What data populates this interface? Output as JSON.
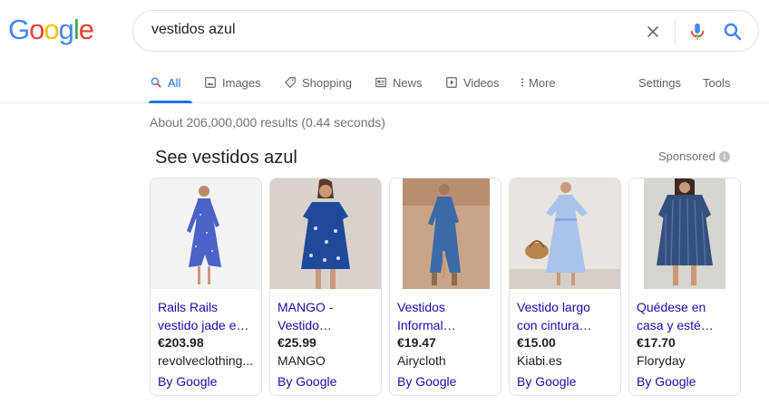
{
  "logo": {
    "letters": [
      "G",
      "o",
      "o",
      "g",
      "l",
      "e"
    ],
    "colors": [
      "#4285f4",
      "#ea4335",
      "#fbbc05",
      "#4285f4",
      "#34a853",
      "#ea4335"
    ]
  },
  "search": {
    "query": "vestidos azul"
  },
  "tabs": [
    {
      "label": "All",
      "icon": "search-icon",
      "active": true
    },
    {
      "label": "Images",
      "icon": "image-icon"
    },
    {
      "label": "Shopping",
      "icon": "tag-icon"
    },
    {
      "label": "News",
      "icon": "newspaper-icon"
    },
    {
      "label": "Videos",
      "icon": "play-icon"
    },
    {
      "label": "More",
      "icon": "more-vert-icon"
    },
    {
      "label": "Settings"
    },
    {
      "label": "Tools"
    }
  ],
  "result_stats": "About 206,000,000 results (0.44 seconds)",
  "shopping": {
    "title": "See vestidos azul",
    "sponsored": "Sponsored",
    "products": [
      {
        "title_line1": "Rails Rails",
        "title_line2": "vestido jade e…",
        "price": "€203.98",
        "merchant": "revolveclothing...",
        "by": "By Google"
      },
      {
        "title_line1": "MANGO -",
        "title_line2": "Vestido…",
        "price": "€25.99",
        "merchant": "MANGO",
        "by": "By Google"
      },
      {
        "title_line1": "Vestidos",
        "title_line2": "Informal…",
        "price": "€19.47",
        "merchant": "Airycloth",
        "by": "By Google"
      },
      {
        "title_line1": "Vestido largo",
        "title_line2": "con cintura…",
        "price": "€15.00",
        "merchant": "Kiabi.es",
        "by": "By Google"
      },
      {
        "title_line1": "Quédese en",
        "title_line2": "casa y esté…",
        "price": "€17.70",
        "merchant": "Floryday",
        "by": "By Google"
      }
    ]
  },
  "colors": {
    "link": "#1a0dab",
    "accent": "#1a73e8",
    "muted": "#70757a"
  }
}
